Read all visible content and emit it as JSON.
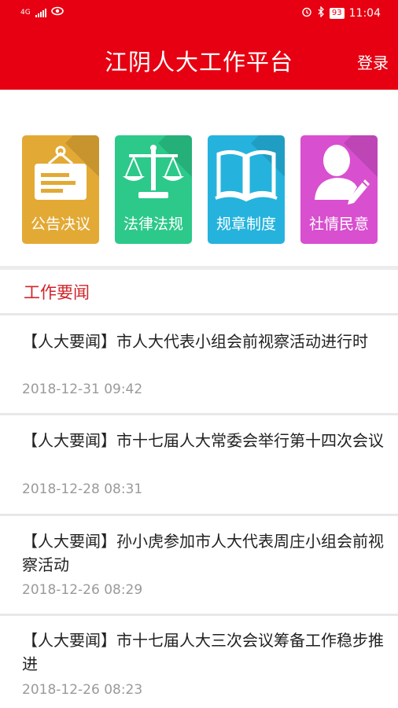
{
  "status_bar": {
    "network": "4G",
    "battery": "93",
    "time": "11:04"
  },
  "header": {
    "title": "江阴人大工作平台",
    "login_label": "登录"
  },
  "tiles": [
    {
      "label": "公告决议",
      "color": "#e3a935",
      "icon": "notice-board-icon"
    },
    {
      "label": "法律法规",
      "color": "#2cc98a",
      "icon": "scales-icon"
    },
    {
      "label": "规章制度",
      "color": "#25b3dd",
      "icon": "open-book-icon"
    },
    {
      "label": "社情民意",
      "color": "#d84fcf",
      "icon": "person-edit-icon"
    }
  ],
  "news": {
    "section_title": "工作要闻",
    "items": [
      {
        "title": "【人大要闻】市人大代表小组会前视察活动进行时",
        "date": "2018-12-31 09:42"
      },
      {
        "title": "【人大要闻】市十七届人大常委会举行第十四次会议",
        "date": "2018-12-28 08:31"
      },
      {
        "title": "【人大要闻】孙小虎参加市人大代表周庄小组会前视察活动",
        "date": "2018-12-26 08:29"
      },
      {
        "title": "【人大要闻】市十七届人大三次会议筹备工作稳步推进",
        "date": "2018-12-26 08:23"
      }
    ]
  }
}
